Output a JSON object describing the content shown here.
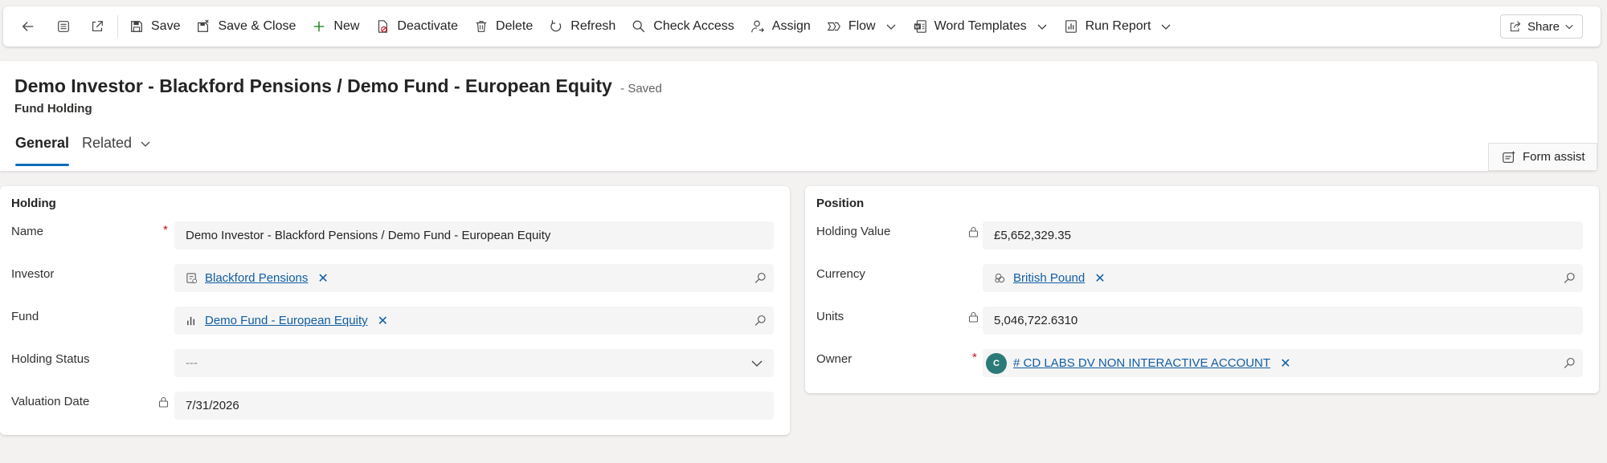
{
  "commandbar": {
    "back_label": "",
    "save": "Save",
    "save_close": "Save & Close",
    "new": "New",
    "deactivate": "Deactivate",
    "delete": "Delete",
    "refresh": "Refresh",
    "check_access": "Check Access",
    "assign": "Assign",
    "flow": "Flow",
    "word_templates": "Word Templates",
    "run_report": "Run Report",
    "share": "Share"
  },
  "header": {
    "title": "Demo Investor - Blackford Pensions / Demo Fund - European Equity",
    "saved_status": "- Saved",
    "entity": "Fund Holding",
    "tabs": [
      "General",
      "Related"
    ],
    "form_assist": "Form assist"
  },
  "holding": {
    "title": "Holding",
    "name_label": "Name",
    "name_value": "Demo Investor - Blackford Pensions / Demo Fund - European Equity",
    "investor_label": "Investor",
    "investor_value": "Blackford Pensions",
    "fund_label": "Fund",
    "fund_value": "Demo Fund - European Equity",
    "status_label": "Holding Status",
    "status_value": "---",
    "valuation_label": "Valuation Date",
    "valuation_value": "7/31/2026"
  },
  "position": {
    "title": "Position",
    "value_label": "Holding Value",
    "value_value": "£5,652,329.35",
    "currency_label": "Currency",
    "currency_value": "British Pound",
    "units_label": "Units",
    "units_value": "5,046,722.6310",
    "owner_label": "Owner",
    "owner_initial": "C",
    "owner_value": "# CD LABS DV NON INTERACTIVE ACCOUNT"
  },
  "colors": {
    "accent": "#0f6cbd",
    "link": "#115ea3",
    "required": "#c50f1f",
    "avatar": "#2b7a78"
  }
}
